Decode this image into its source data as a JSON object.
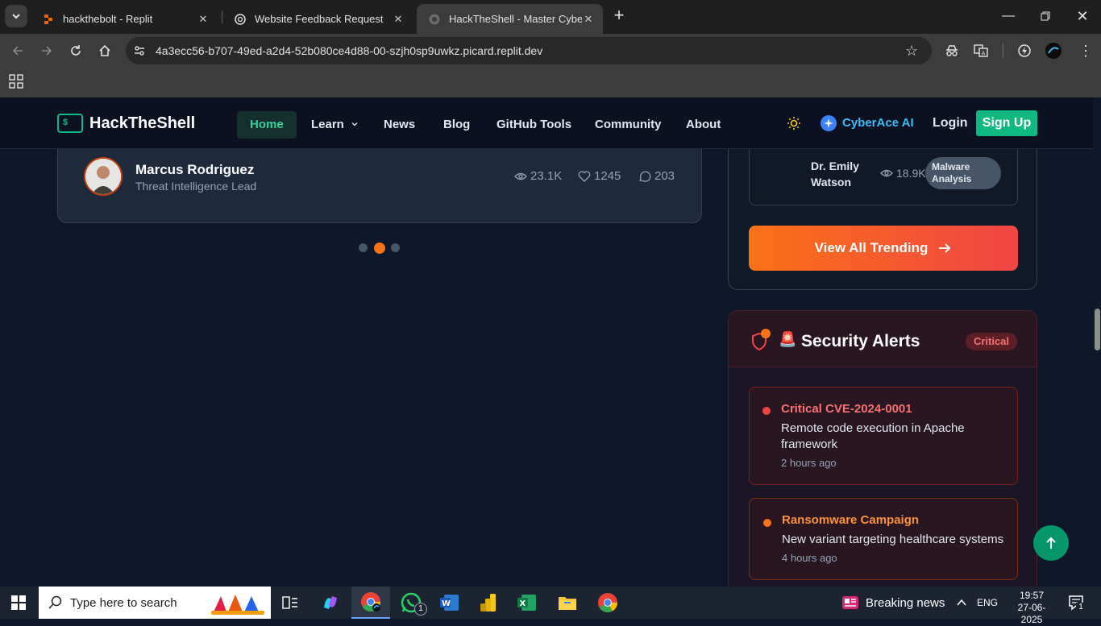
{
  "browser": {
    "tabs": [
      {
        "title": "hackthebolt - Replit",
        "icon": "replit-icon"
      },
      {
        "title": "Website Feedback Request",
        "icon": "openai-icon"
      },
      {
        "title": "HackTheShell - Master Cyberse",
        "icon": "globe-icon"
      }
    ],
    "url": "4a3ecc56-b707-49ed-a2d4-52b080ce4d88-00-szjh0sp9uwkz.picard.replit.dev"
  },
  "site": {
    "brand": "HackTheShell",
    "logo_glyph": "$",
    "nav": {
      "home": "Home",
      "learn": "Learn",
      "news": "News",
      "blog": "Blog",
      "github": "GitHub Tools",
      "community": "Community",
      "about": "About"
    },
    "ai_label": "CyberAce AI",
    "login": "Login",
    "signup": "Sign Up"
  },
  "featured_post": {
    "author": "Marcus Rodriguez",
    "role": "Threat Intelligence Lead",
    "views": "23.1K",
    "likes": "1245",
    "comments": "203"
  },
  "trending": {
    "last_item": {
      "author_line1": "Dr. Emily",
      "author_line2": "Watson",
      "views": "18.9K",
      "tag_line1": "Malware",
      "tag_line2": "Analysis"
    },
    "view_all": "View All Trending"
  },
  "alerts": {
    "emoji": "🚨",
    "title": "Security Alerts",
    "badge": "Critical",
    "items": [
      {
        "title": "Critical CVE-2024-0001",
        "desc_line1": "Remote code execution in Apache",
        "desc_line2": "framework",
        "time": "2 hours ago",
        "color": "#ef4444"
      },
      {
        "title": "Ransomware Campaign",
        "desc_line1": "New variant targeting healthcare systems",
        "desc_line2": "",
        "time": "4 hours ago",
        "color": "#f97316"
      }
    ]
  },
  "taskbar": {
    "search_placeholder": "Type here to search",
    "news": "Breaking news",
    "lang": "ENG",
    "time": "19:57",
    "date": "27-06-2025",
    "whatsapp_badge": "1",
    "notif_badge": "1"
  },
  "colors": {
    "accent_green": "#10b981",
    "accent_orange": "#f97316",
    "alert_red": "#ef4444"
  }
}
